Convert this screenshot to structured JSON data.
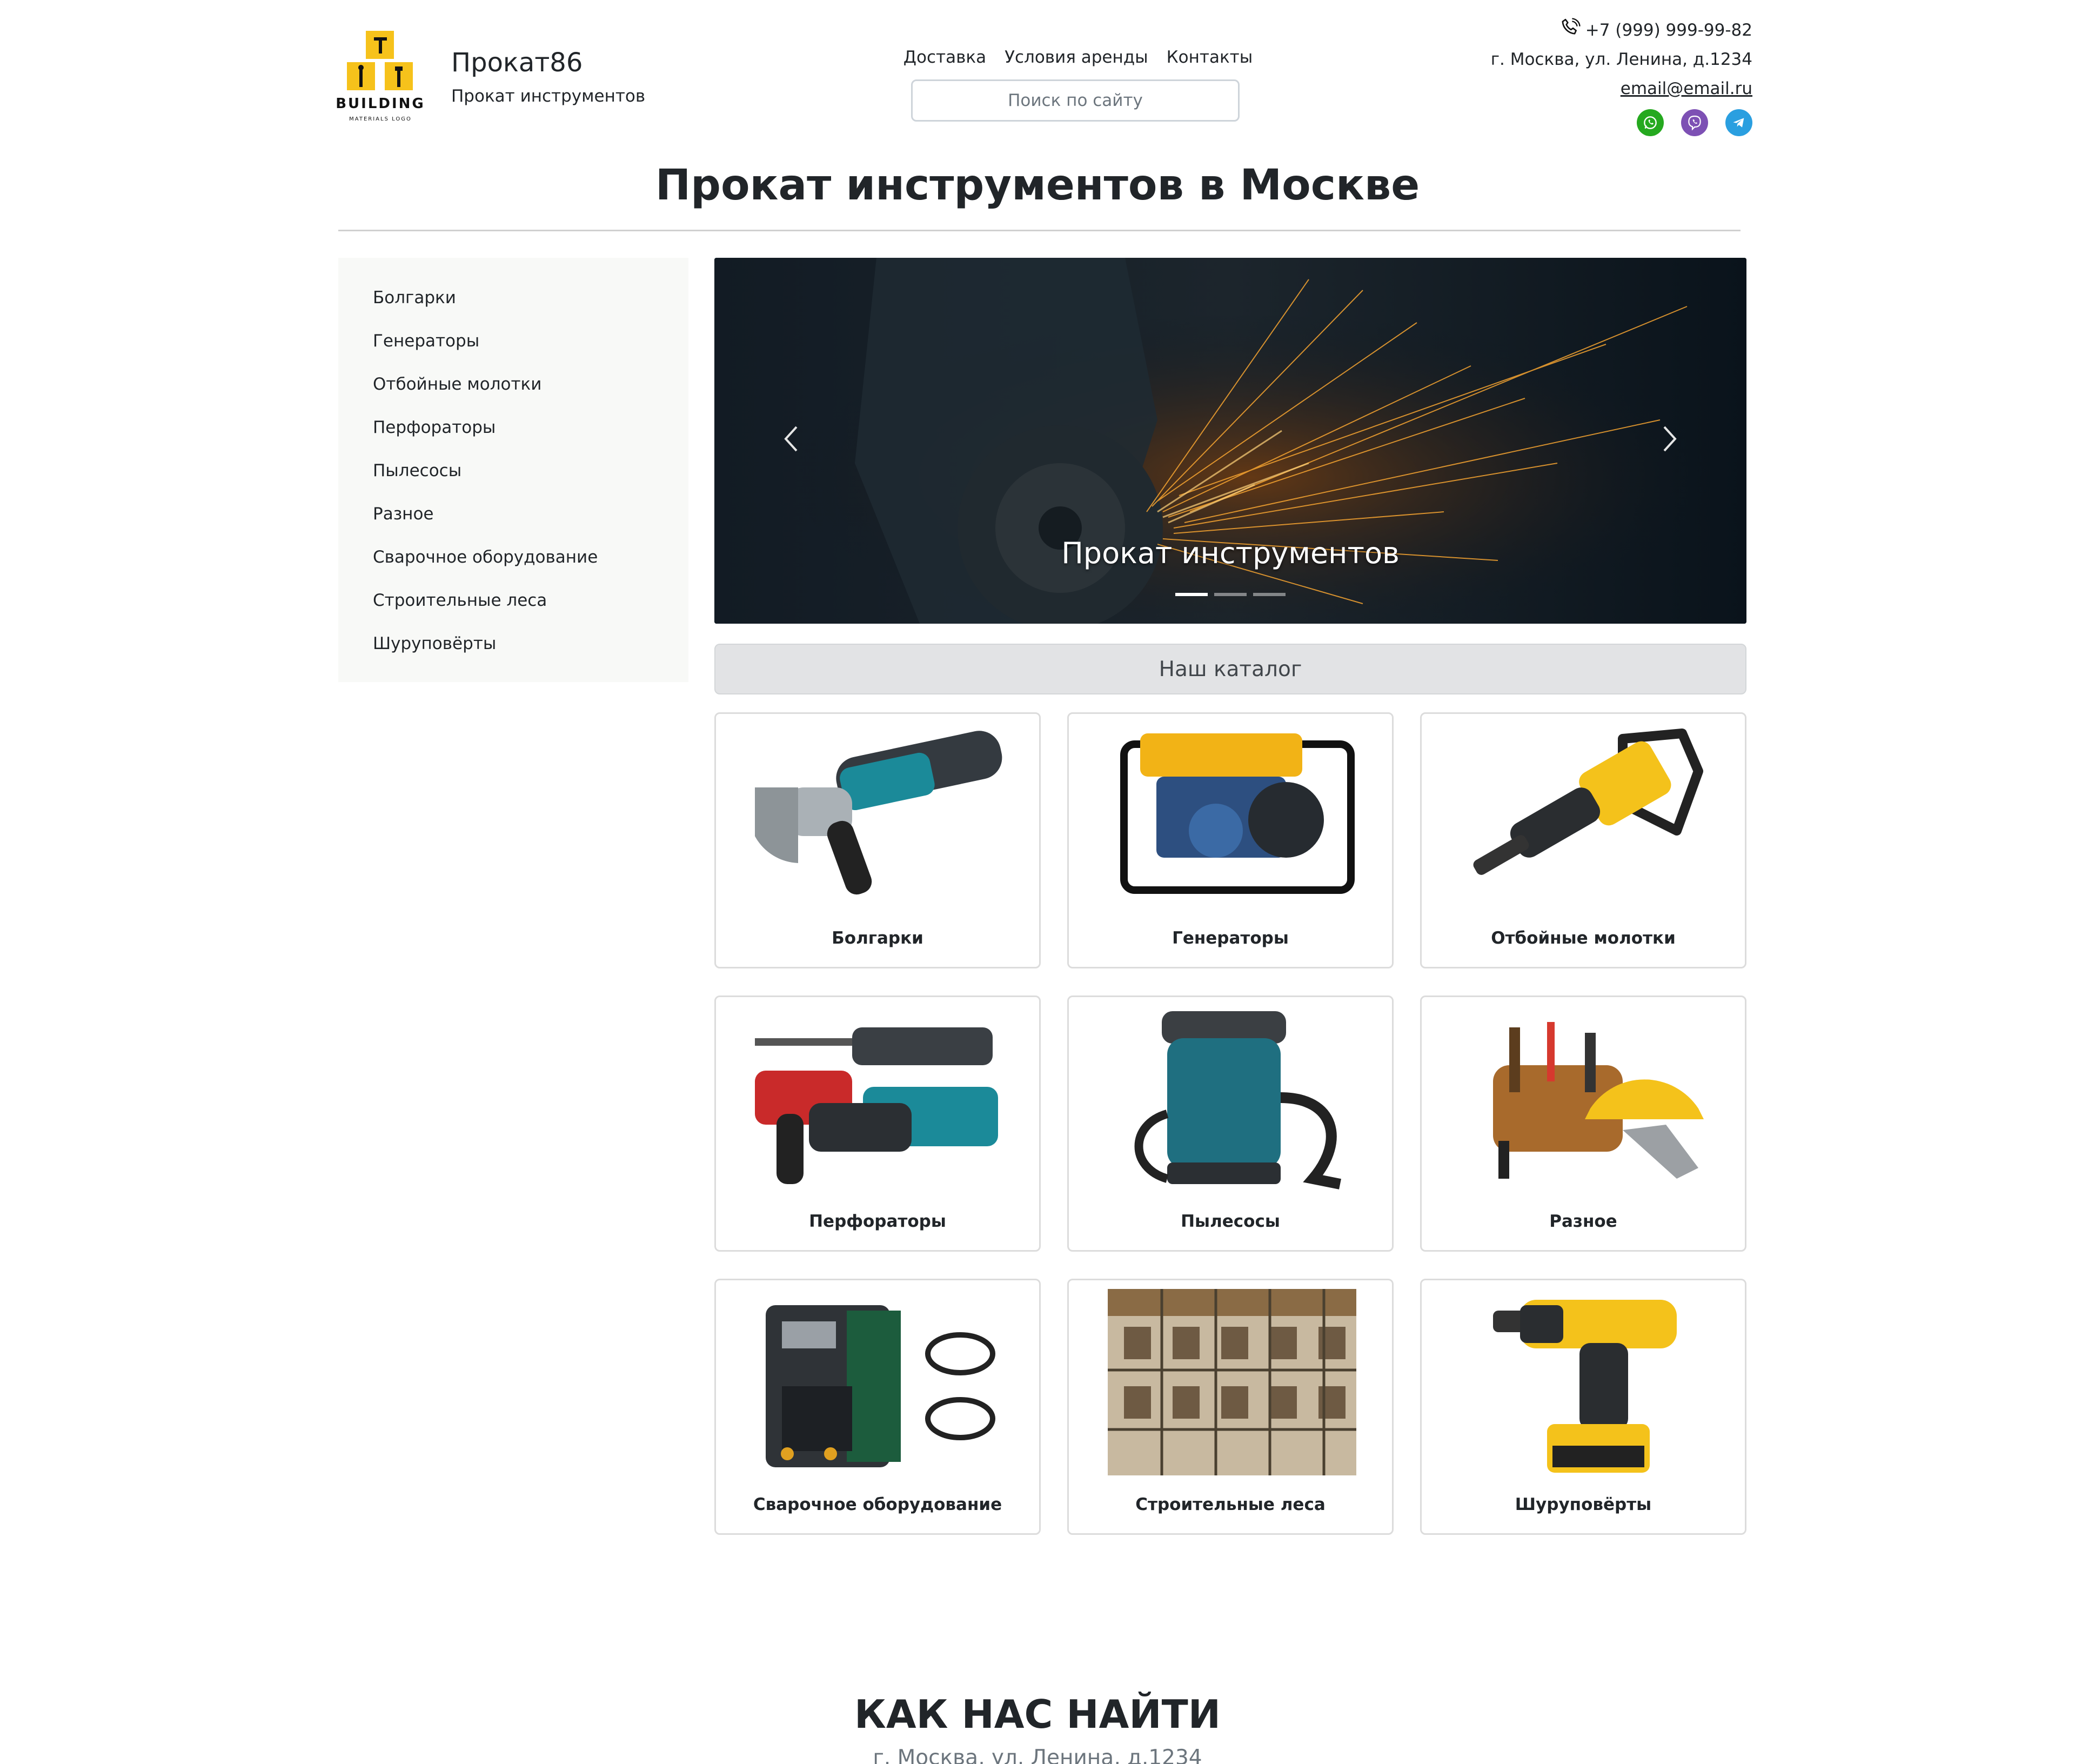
{
  "header": {
    "logo_text": "BUILDING",
    "logo_subtext": "MATERIALS LOGO",
    "brand_name": "Прокат86",
    "brand_tagline": "Прокат инструментов",
    "nav": [
      {
        "label": "Доставка"
      },
      {
        "label": "Условия аренды"
      },
      {
        "label": "Контакты"
      }
    ],
    "search_placeholder": "Поиск по сайту",
    "phone": "+7 (999) 999-99-82",
    "address": "г. Москва, ул. Ленина, д.1234",
    "email": "email@email.ru",
    "socials": [
      {
        "icon": "whatsapp-icon",
        "color": "#25a91f"
      },
      {
        "icon": "viber-icon",
        "color": "#7d50b4"
      },
      {
        "icon": "telegram-icon",
        "color": "#2a9fe0"
      }
    ]
  },
  "page_title": "Прокат инструментов в Москве",
  "sidebar": {
    "items": [
      {
        "label": "Болгарки"
      },
      {
        "label": "Генераторы"
      },
      {
        "label": "Отбойные молотки"
      },
      {
        "label": "Перфораторы"
      },
      {
        "label": "Пылесосы"
      },
      {
        "label": "Разное"
      },
      {
        "label": "Сварочное оборудование"
      },
      {
        "label": "Строительные леса"
      },
      {
        "label": "Шуруповёрты"
      }
    ]
  },
  "hero": {
    "caption": "Прокат инструментов",
    "slides_count": 3,
    "active_slide": 1
  },
  "catalog": {
    "title": "Наш каталог",
    "items": [
      {
        "label": "Болгарки",
        "image": "angle-grinder"
      },
      {
        "label": "Генераторы",
        "image": "generator"
      },
      {
        "label": "Отбойные молотки",
        "image": "demolition-hammer"
      },
      {
        "label": "Перфораторы",
        "image": "rotary-hammers"
      },
      {
        "label": "Пылесосы",
        "image": "vacuum-cleaner"
      },
      {
        "label": "Разное",
        "image": "tool-belt-helmet"
      },
      {
        "label": "Сварочное оборудование",
        "image": "welding-machine"
      },
      {
        "label": "Строительные леса",
        "image": "scaffolding"
      },
      {
        "label": "Шуруповёрты",
        "image": "drill"
      }
    ]
  },
  "find_us": {
    "title": "КАК НАС НАЙТИ",
    "address": "г. Москва, ул. Ленина, д.1234"
  }
}
